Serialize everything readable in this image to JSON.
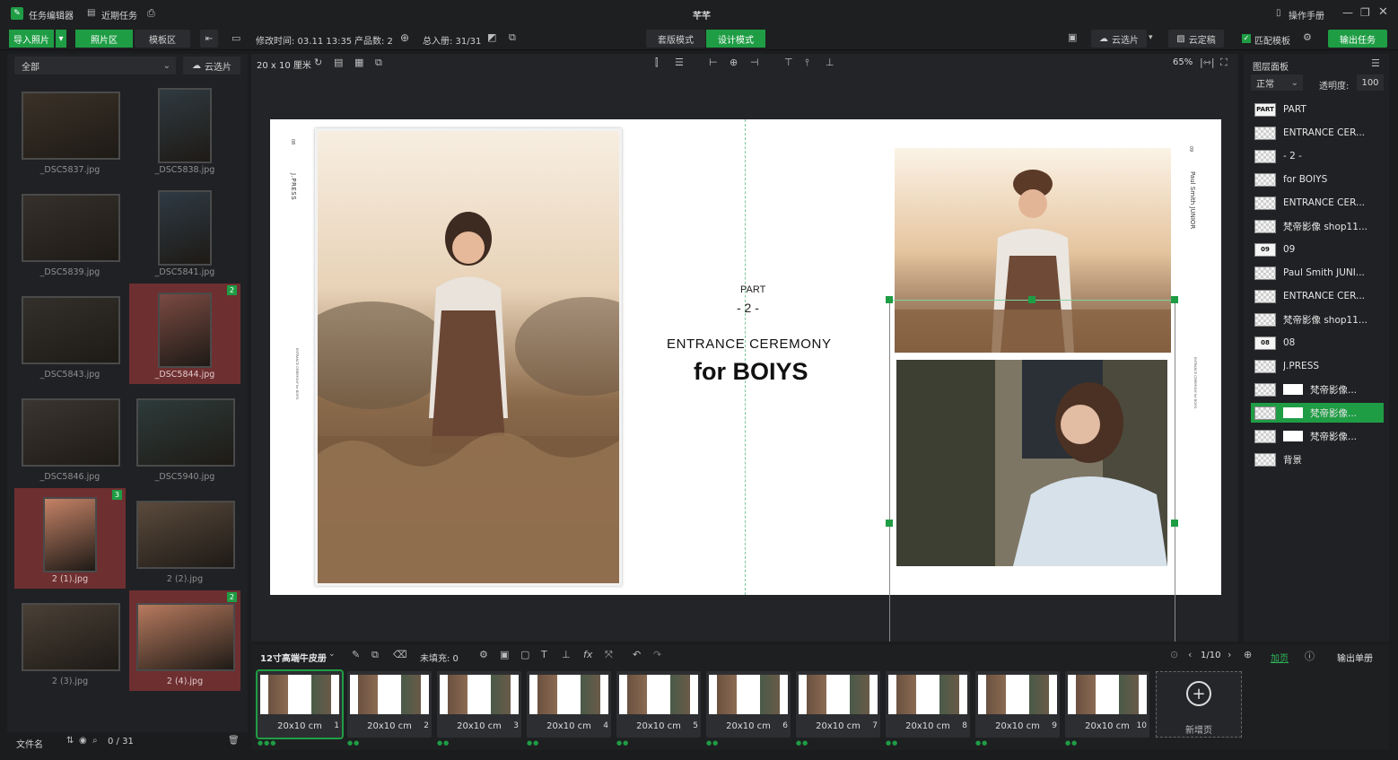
{
  "titlebar": {
    "app_name": "任务编辑器",
    "recent": "近期任务",
    "center_title": "芊芊",
    "manual": "操作手册"
  },
  "toolbar": {
    "import": "导入照片",
    "photo_tab": "照片区",
    "template_tab": "模板区",
    "modified_label": "修改时间: 03.11 13:35",
    "product_count_label": "产品数: 2",
    "total_label": "总入册: 31/31",
    "set_mode": "套版模式",
    "design_mode": "设计模式",
    "cloud_select": "云选片",
    "cloud_final": "云定稿",
    "match_template": "匹配模板",
    "export": "输出任务"
  },
  "left": {
    "filter_value": "全部",
    "cloud_select": "云选片",
    "footer_label": "文件名",
    "footer_count": "0 / 31",
    "thumbs": [
      {
        "name": "_DSC5837.jpg",
        "selected": false,
        "badge": ""
      },
      {
        "name": "_DSC5838.jpg",
        "selected": false,
        "badge": ""
      },
      {
        "name": "_DSC5839.jpg",
        "selected": false,
        "badge": ""
      },
      {
        "name": "_DSC5841.jpg",
        "selected": false,
        "badge": ""
      },
      {
        "name": "_DSC5843.jpg",
        "selected": false,
        "badge": ""
      },
      {
        "name": "_DSC5844.jpg",
        "selected": true,
        "badge": "2"
      },
      {
        "name": "_DSC5846.jpg",
        "selected": false,
        "badge": ""
      },
      {
        "name": "_DSC5940.jpg",
        "selected": false,
        "badge": ""
      },
      {
        "name": "2 (1).jpg",
        "selected": true,
        "badge": "3"
      },
      {
        "name": "2 (2).jpg",
        "selected": false,
        "badge": ""
      },
      {
        "name": "2 (3).jpg",
        "selected": false,
        "badge": ""
      },
      {
        "name": "2 (4).jpg",
        "selected": true,
        "badge": "2"
      }
    ]
  },
  "canvas": {
    "size_label": "20 x 10 厘米",
    "zoom": "65%",
    "part": "PART",
    "part_num": "- 2 -",
    "subtitle": "ENTRANCE CEREMONY",
    "title": "for BOIYS",
    "left_vertical": "J.PRESS",
    "left_mark": "08",
    "right_vertical": "Paul Smith JUNIOR",
    "right_mark": "09",
    "small_vertical": "ENTRANCE CEREMONY for BOIYS"
  },
  "layers_panel": {
    "title": "图层面板",
    "blend_mode": "正常",
    "opacity_label": "透明度:",
    "opacity_value": "100",
    "items": [
      {
        "name": "PART",
        "thumb": "PART"
      },
      {
        "name": "ENTRANCE CER...",
        "thumb": ""
      },
      {
        "name": "- 2 -",
        "thumb": ""
      },
      {
        "name": "for BOIYS",
        "thumb": ""
      },
      {
        "name": "ENTRANCE CER...",
        "thumb": ""
      },
      {
        "name": "梵帝影像 shop11...",
        "thumb": ""
      },
      {
        "name": "09",
        "thumb": "09"
      },
      {
        "name": "Paul Smith JUNI...",
        "thumb": ""
      },
      {
        "name": "ENTRANCE CER...",
        "thumb": ""
      },
      {
        "name": "梵帝影像 shop11...",
        "thumb": ""
      },
      {
        "name": "08",
        "thumb": "08"
      },
      {
        "name": "J.PRESS",
        "thumb": ""
      },
      {
        "name": "梵帝影像...",
        "thumb": ""
      },
      {
        "name": "梵帝影像...",
        "thumb": ""
      },
      {
        "name": "梵帝影像...",
        "thumb": ""
      },
      {
        "name": "背景",
        "thumb": ""
      }
    ]
  },
  "bottom": {
    "product_name": "12寸高端牛皮册",
    "unfilled_label": "未填充: 0",
    "page_indicator": "1/10",
    "add_page": "加页",
    "export_single": "输出单册",
    "new_page": "新增页",
    "frames": [
      {
        "label": "20x10 cm",
        "num": "1"
      },
      {
        "label": "20x10 cm",
        "num": "2"
      },
      {
        "label": "20x10 cm",
        "num": "3"
      },
      {
        "label": "20x10 cm",
        "num": "4"
      },
      {
        "label": "20x10 cm",
        "num": "5"
      },
      {
        "label": "20x10 cm",
        "num": "6"
      },
      {
        "label": "20x10 cm",
        "num": "7"
      },
      {
        "label": "20x10 cm",
        "num": "8"
      },
      {
        "label": "20x10 cm",
        "num": "9"
      },
      {
        "label": "20x10 cm",
        "num": "10"
      }
    ]
  }
}
